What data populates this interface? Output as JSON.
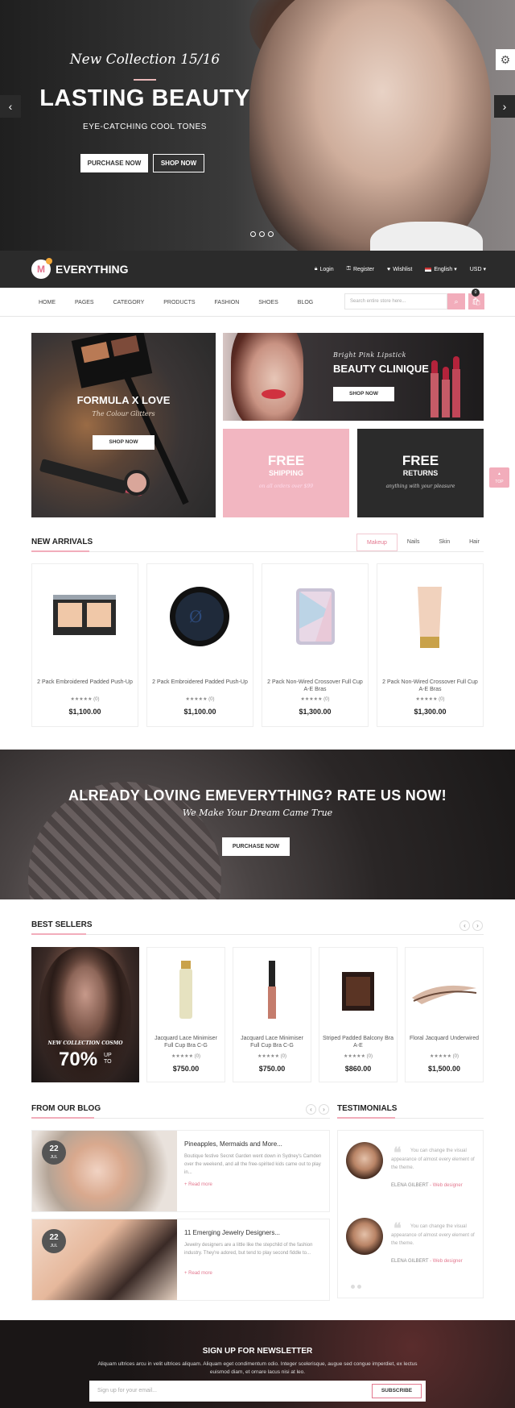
{
  "hero": {
    "subtitle": "New Collection 15/16",
    "title": "LASTING BEAUTY",
    "tagline": "EYE-CATCHING COOL TONES",
    "btn_purchase": "PURCHASE NOW",
    "btn_shop": "SHOP NOW",
    "prev_icon": "‹",
    "next_icon": "›"
  },
  "settings_icon": "⚙",
  "topbar": {
    "logo_letter": "M",
    "brand": "EVERYTHING",
    "login": "Login",
    "register": "Register",
    "wishlist": "Wishlist",
    "language": "English ▾",
    "currency": "USD ▾"
  },
  "nav": {
    "items": [
      "HOME",
      "PAGES",
      "CATEGORY",
      "PRODUCTS",
      "FASHION",
      "SHOES",
      "BLOG"
    ],
    "search_placeholder": "Search entire store here...",
    "cart_count": "0"
  },
  "banners": {
    "left_title": "FORMULA X LOVE",
    "left_sub": "The Colour Glitters",
    "left_btn": "SHOP NOW",
    "top_sub": "Bright Pink Lipstick",
    "top_title": "BEAUTY CLINIQUE",
    "top_btn": "SHOP NOW",
    "free1_big": "FREE",
    "free1_mid": "SHIPPING",
    "free1_sm": "on all orders over $99",
    "free2_big": "FREE",
    "free2_mid": "RETURNS",
    "free2_sm": "anything with your pleasure"
  },
  "new_arrivals": {
    "title": "NEW ARRIVALS",
    "tabs": [
      "Makeup",
      "Nails",
      "Skin",
      "Hair"
    ],
    "products": [
      {
        "name": "2 Pack Embroidered Padded Push-Up",
        "stars": "★★★★★ (0)",
        "price": "$1,100.00"
      },
      {
        "name": "2 Pack Embroidered Padded Push-Up",
        "stars": "★★★★★ (0)",
        "price": "$1,100.00"
      },
      {
        "name": "2 Pack Non-Wired Crossover Full Cup A-E Bras",
        "stars": "★★★★★ (0)",
        "price": "$1,300.00"
      },
      {
        "name": "2 Pack Non-Wired Crossover Full Cup A-E Bras",
        "stars": "★★★★★ (0)",
        "price": "$1,300.00"
      }
    ]
  },
  "rate": {
    "title": "ALREADY LOVING EMEVERYTHING? RATE US NOW!",
    "subtitle": "We Make Your Dream Came True",
    "btn": "PURCHASE NOW"
  },
  "best_sellers": {
    "title": "BEST SELLERS",
    "promo_sub": "NEW COLLECTION COSMO",
    "promo_pct": "70%",
    "promo_up": "UP",
    "promo_to": "TO",
    "products": [
      {
        "name": "Jacquard Lace Minimiser Full Cup Bra C-G",
        "stars": "★★★★★ (0)",
        "price": "$750.00"
      },
      {
        "name": "Jacquard Lace Minimiser Full Cup Bra C-G",
        "stars": "★★★★★ (0)",
        "price": "$750.00"
      },
      {
        "name": "Striped Padded Balcony Bra A-E",
        "stars": "★★★★★ (0)",
        "price": "$860.00"
      },
      {
        "name": "Floral Jacquard Underwired",
        "stars": "★★★★★ (0)",
        "price": "$1,500.00"
      }
    ]
  },
  "blog": {
    "title": "FROM OUR BLOG",
    "posts": [
      {
        "day": "22",
        "month": "JUL",
        "title": "Pineapples, Mermaids and More...",
        "text": "Boutique festive Secret Garden went down in Sydney's Camden over the weekend, and all the free-spirited kids came out to play in...",
        "more": "+ Read more"
      },
      {
        "day": "22",
        "month": "JUL",
        "title": "11 Emerging Jewelry Designers...",
        "text": "Jewelry designers are a little like the stepchild of the fashion industry. They're adored, but tend to play second fiddle to...",
        "more": "+ Read more"
      }
    ]
  },
  "testimonials": {
    "title": "TESTIMONIALS",
    "items": [
      {
        "text": "You can change the visual appearance of almost every element of the theme.",
        "name": "ELENA GILBERT",
        "role": "- Web designer"
      },
      {
        "text": "You can change the visual appearance of almost every element of the theme.",
        "name": "ELENA GILBERT",
        "role": "- Web designer"
      }
    ]
  },
  "newsletter": {
    "title": "SIGN UP FOR NEWSLETTER",
    "text": "Aliquam ultrices arcu in velit ultrices aliquam. Aliquam eget condimentum odio. Integer scelerisque, augue sed congue imperdiet, ex lectus euismod diam, et ornare lacus nisi at leo.",
    "placeholder": "Sign up for your email...",
    "btn": "SUBSCRIBE"
  },
  "top_btn": {
    "arrow": "▲",
    "label": "TOP"
  },
  "colors": {
    "accent": "#f2adbb",
    "dark": "#2b2b2b"
  }
}
